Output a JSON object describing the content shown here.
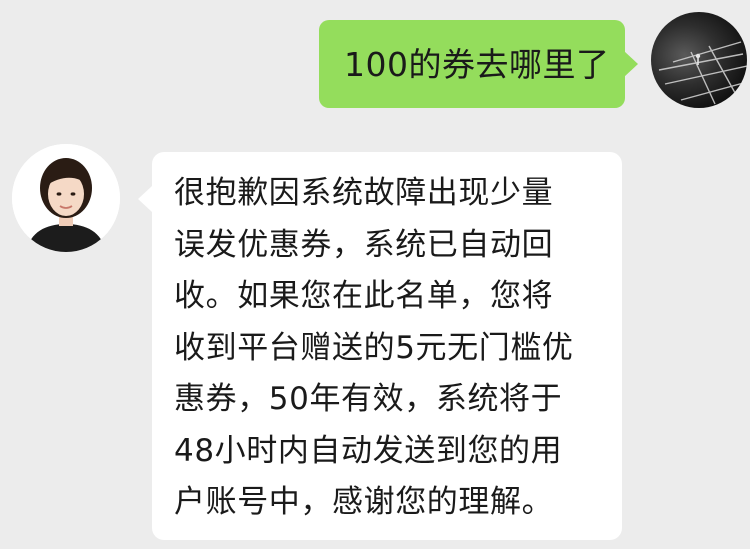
{
  "conversation": {
    "messages": [
      {
        "direction": "sent",
        "avatar": "dark-court-photo-avatar",
        "text": "100的券去哪里了"
      },
      {
        "direction": "received",
        "avatar": "woman-portrait-avatar",
        "lines": [
          "很抱歉因系统故障出现少量",
          "误发优惠券，系统已自动回",
          "收。如果您在此名单，您将",
          "收到平台赠送的5元无门槛优",
          "惠券，50年有效，系统将于",
          "48小时内自动发送到您的用",
          "户账号中，感谢您的理解。"
        ]
      }
    ]
  },
  "colors": {
    "background": "#ececec",
    "sent_bubble": "#94dd5c",
    "received_bubble": "#ffffff",
    "text": "#1a1a1a"
  }
}
